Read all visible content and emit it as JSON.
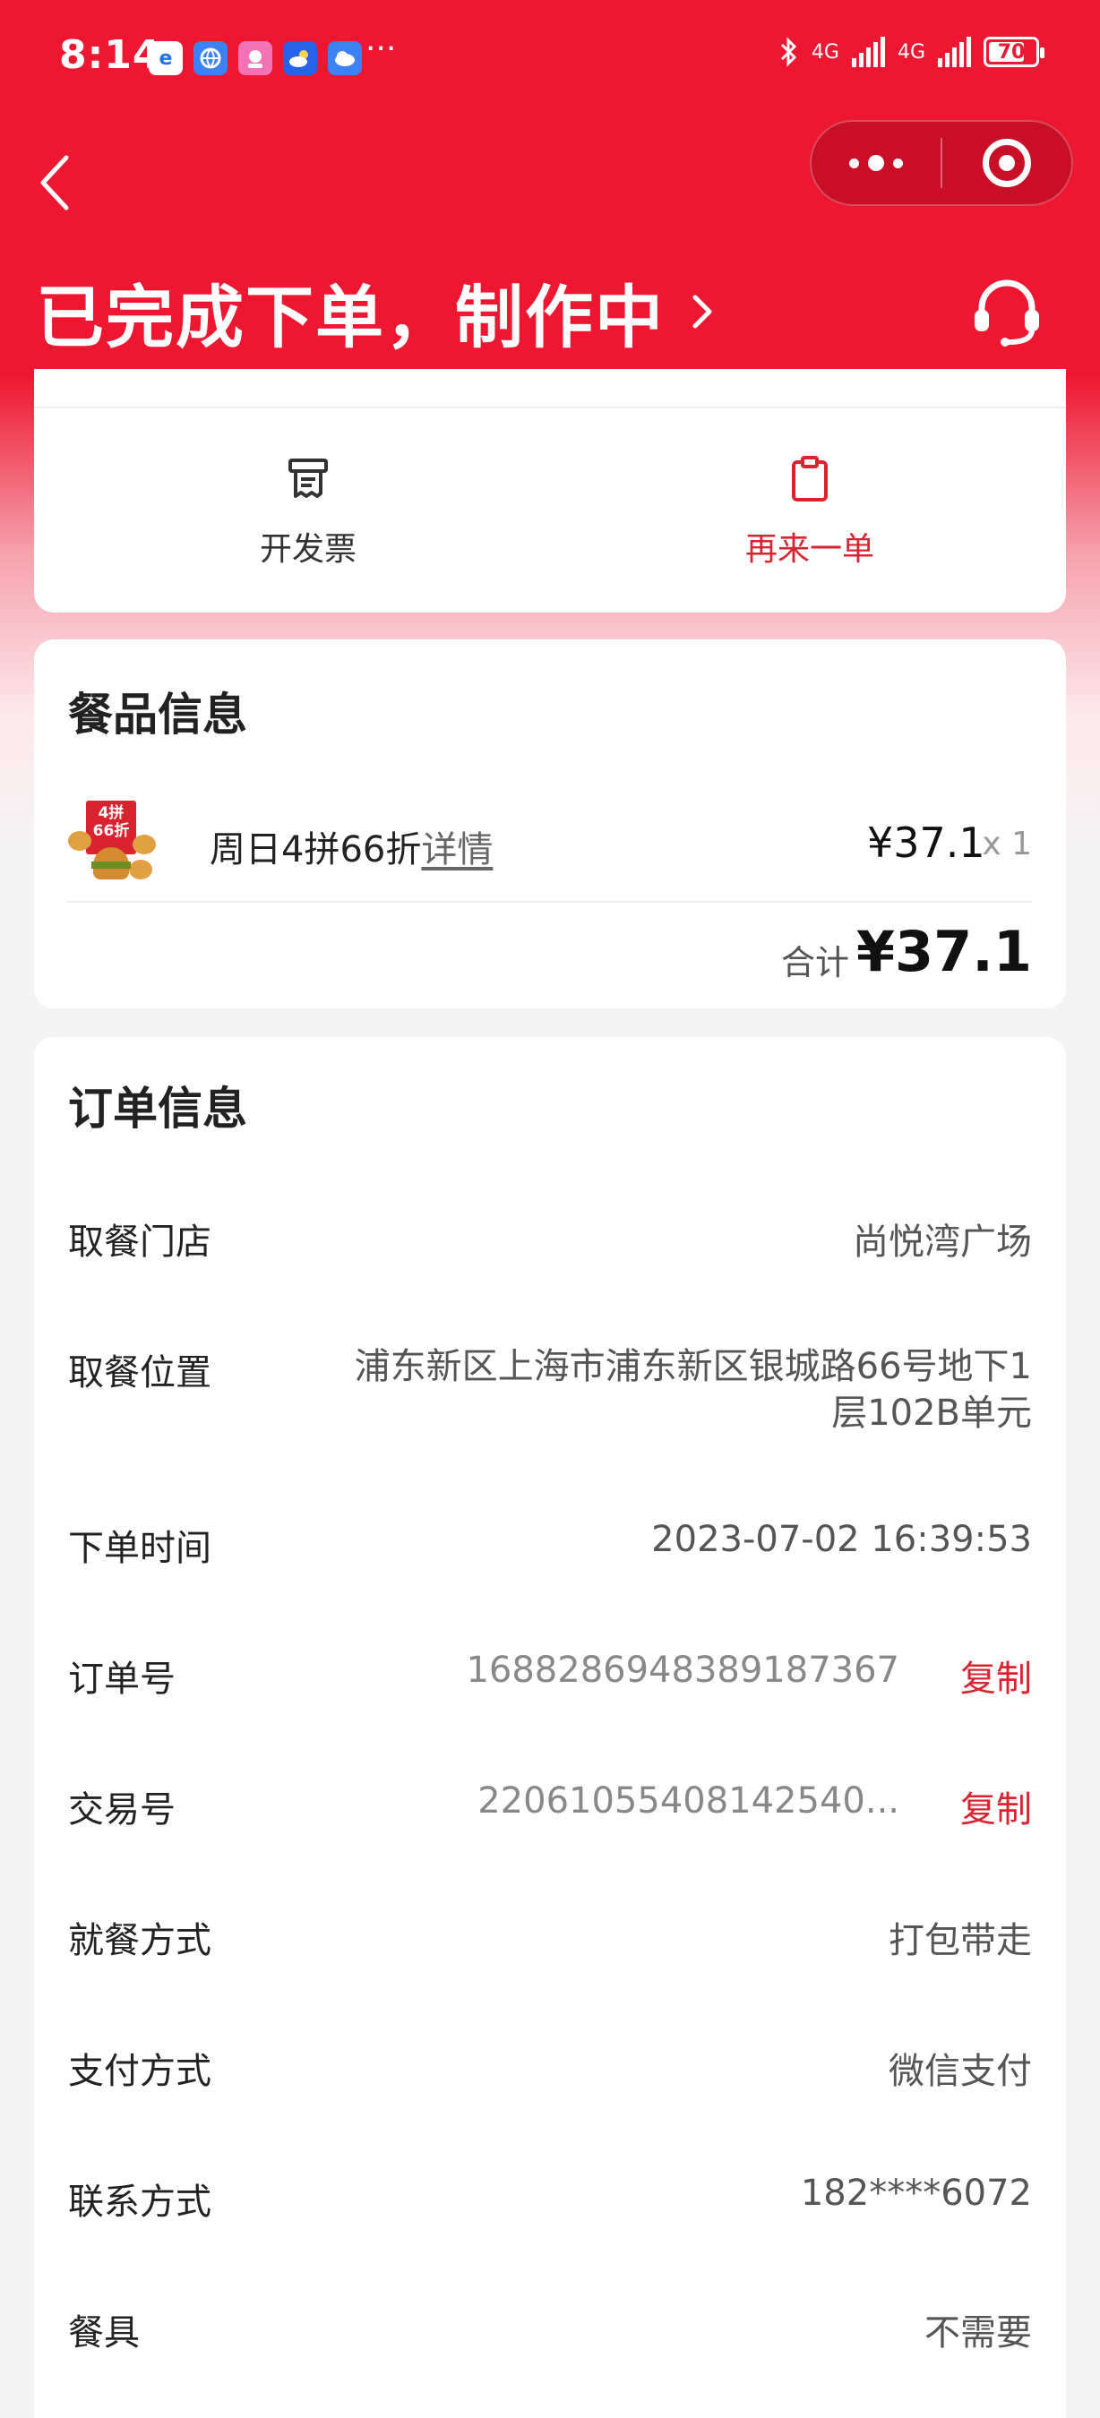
{
  "status_bar": {
    "time": "8:14",
    "network_1": "4G",
    "network_2": "4G",
    "battery": "70",
    "overflow": "···"
  },
  "colors": {
    "brand_red": "#ee1732",
    "accent_red": "#d9232f"
  },
  "header": {
    "order_status": "已完成下单，制作中"
  },
  "actions": {
    "invoice_label": "开发票",
    "reorder_label": "再来一单"
  },
  "food": {
    "section_title": "餐品信息",
    "item": {
      "name": "周日4拼66折",
      "detail_link": "详情",
      "price": "¥37.1",
      "qty": "x 1",
      "badge_line1": "4拼",
      "badge_line2": "66折"
    },
    "total_label": "合计",
    "total_value": "¥37.1"
  },
  "order": {
    "section_title": "订单信息",
    "rows": [
      {
        "label": "取餐门店",
        "value": "尚悦湾广场"
      },
      {
        "label": "取餐位置",
        "value": "浦东新区上海市浦东新区银城路66号地下1层102B单元"
      },
      {
        "label": "下单时间",
        "value": "2023-07-02 16:39:53"
      },
      {
        "label": "订单号",
        "value": "1688286948389187367",
        "action": "复制"
      },
      {
        "label": "交易号",
        "value": "22061055408142540...",
        "action": "复制"
      },
      {
        "label": "就餐方式",
        "value": "打包带走"
      },
      {
        "label": "支付方式",
        "value": "微信支付"
      },
      {
        "label": "联系方式",
        "value": "182****6072"
      },
      {
        "label": "餐具",
        "value": "不需要"
      }
    ]
  }
}
